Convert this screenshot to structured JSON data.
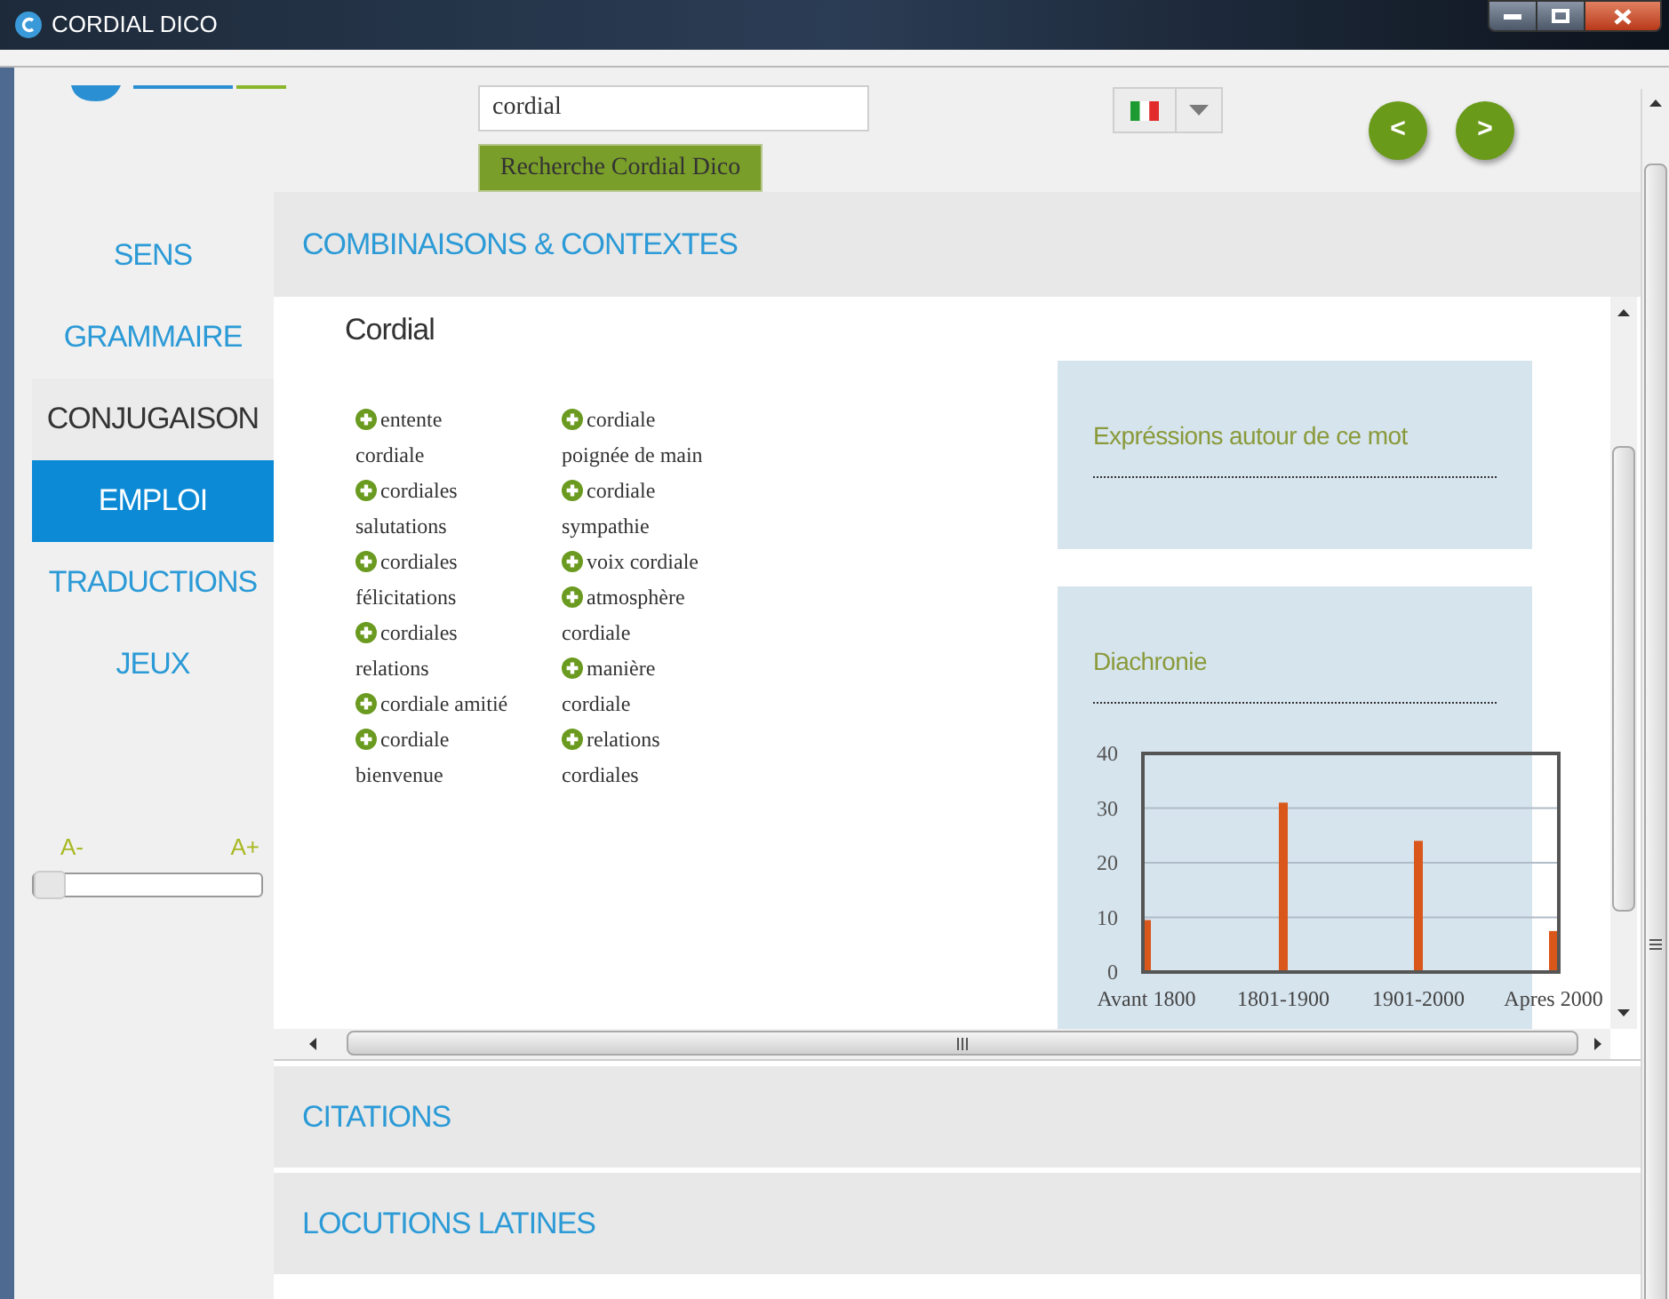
{
  "window": {
    "title": "CORDIAL DICO"
  },
  "search": {
    "value": "cordial",
    "button": "Recherche Cordial Dico"
  },
  "nav_buttons": [
    "<",
    ">"
  ],
  "sidebar": {
    "items": [
      {
        "label": "SENS",
        "selected": false,
        "hovered": false
      },
      {
        "label": "GRAMMAIRE",
        "selected": false,
        "hovered": false
      },
      {
        "label": "CONJUGAISON",
        "selected": false,
        "hovered": true
      },
      {
        "label": "EMPLOI",
        "selected": true,
        "hovered": false
      },
      {
        "label": "TRADUCTIONS",
        "selected": false,
        "hovered": false
      },
      {
        "label": "JEUX",
        "selected": false,
        "hovered": false
      }
    ]
  },
  "font_size": {
    "min_label": "A-",
    "max_label": "A+",
    "level": 0
  },
  "sections": [
    {
      "title": "COMBINAISONS & CONTEXTES",
      "expanded": true
    },
    {
      "title": "CITATIONS",
      "expanded": false
    },
    {
      "title": "LOCUTIONS LATINES",
      "expanded": false
    }
  ],
  "entry": {
    "word": "Cordial",
    "columns": [
      {
        "items": [
          "entente cordiale",
          "cordiales salutations",
          "cordiales félicitations",
          "cordiales relations",
          "cordiale amitié",
          "cordiale bienvenue"
        ]
      },
      {
        "items": [
          "cordiale poignée de main",
          "cordiale sympathie",
          "voix cordiale",
          "atmosphère cordiale",
          "manière cordiale",
          "relations cordiales"
        ]
      }
    ]
  },
  "expressions": {
    "title": "Expréssions autour de ce mot"
  },
  "diachronie": {
    "title": "Diachronie",
    "chart_data": {
      "type": "bar",
      "categories": [
        "Avant 1800",
        "1801-1900",
        "1901-2000",
        "Apres 2000"
      ],
      "series": [
        {
          "color": "#d9571a",
          "values": [
            9.5,
            31,
            24,
            7.5
          ]
        }
      ],
      "grid": true,
      "ylim": [
        0,
        40
      ],
      "yticks": [
        0,
        10,
        20,
        30,
        40
      ]
    }
  }
}
